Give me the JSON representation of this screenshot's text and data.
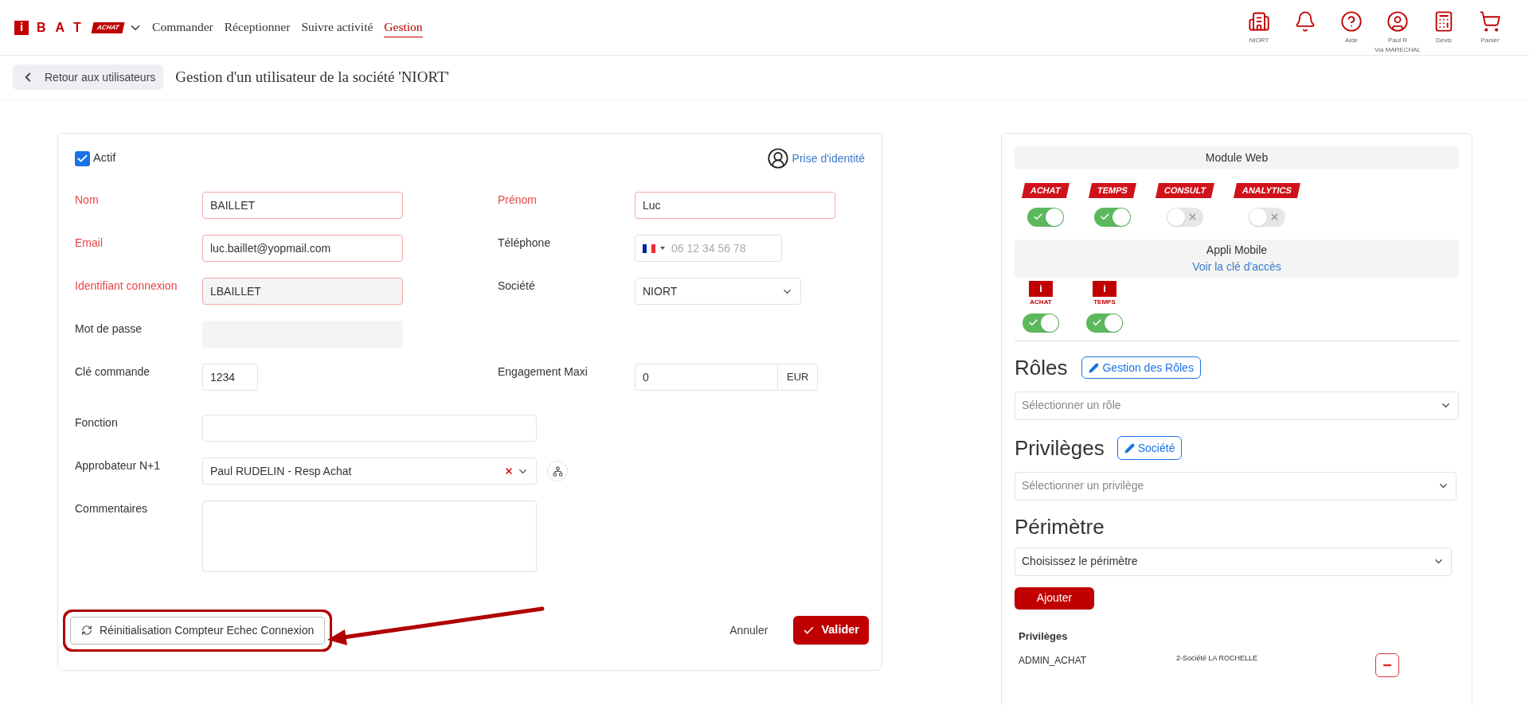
{
  "header": {
    "logo": {
      "mark": "i",
      "name": "BAT",
      "tag": "ACHAT"
    },
    "nav": [
      {
        "label": "Commander",
        "selected": false
      },
      {
        "label": "Réceptionner",
        "selected": false
      },
      {
        "label": "Suivre activité",
        "selected": false
      },
      {
        "label": "Gestion",
        "selected": true
      }
    ],
    "actions": [
      {
        "kind": "building",
        "label": "NIORT"
      },
      {
        "kind": "bell"
      },
      {
        "kind": "help",
        "label": "Aide"
      },
      {
        "kind": "user",
        "label": "Paul R",
        "sublabel": "Via MARECHAL"
      },
      {
        "kind": "calculator",
        "label": "Devis"
      },
      {
        "kind": "cart",
        "label": "Panier"
      }
    ]
  },
  "subheader": {
    "back_button": "Retour aux utilisateurs",
    "title": "Gestion d'un utilisateur de la société 'NIORT'"
  },
  "user_form": {
    "active": {
      "label": "Actif",
      "checked": true
    },
    "impersonate_link": "Prise d'identité",
    "rows": [
      {
        "fields": [
          {
            "kind": "text",
            "label": "Nom",
            "required": true,
            "disabled": false,
            "value": "BAILLET"
          },
          {
            "kind": "text",
            "label": "Prénom",
            "required": true,
            "disabled": false,
            "value": "Luc"
          }
        ]
      },
      {
        "fields": [
          {
            "kind": "text",
            "label": "Email",
            "required": true,
            "disabled": false,
            "value": "luc.baillet@yopmail.com"
          },
          {
            "kind": "phone",
            "label": "Téléphone",
            "required": false,
            "disabled": false,
            "placeholder": "06 12 34 56 78"
          }
        ]
      },
      {
        "fields": [
          {
            "kind": "text",
            "label": "Identifiant connexion",
            "required": true,
            "disabled": true,
            "value": "LBAILLET"
          },
          {
            "kind": "select",
            "label": "Société",
            "required": false,
            "disabled": false,
            "value": "NIORT"
          }
        ]
      },
      {
        "fields": [
          {
            "kind": "text",
            "label": "Mot de passe",
            "required": false,
            "disabled": true
          }
        ]
      },
      {
        "fields": [
          {
            "kind": "short",
            "label": "Clé commande",
            "required": false,
            "disabled": false,
            "value": "1234"
          },
          {
            "kind": "currency",
            "label": "Engagement Maxi",
            "required": false,
            "disabled": false,
            "value": "0",
            "unit": "EUR"
          }
        ]
      },
      {
        "fields": [
          {
            "kind": "wide",
            "label": "Fonction",
            "required": false,
            "disabled": false
          }
        ]
      },
      {
        "fields": [
          {
            "kind": "combo",
            "label": "Approbateur N+1",
            "required": false,
            "disabled": false,
            "value": "Paul RUDELIN - Resp Achat"
          }
        ]
      },
      {
        "fields": [
          {
            "kind": "textarea",
            "label": "Commentaires",
            "required": false,
            "disabled": false
          }
        ]
      }
    ],
    "reset_button": "Réinitialisation Compteur Echec Connexion",
    "cancel_button": "Annuler",
    "submit_button": "Valider"
  },
  "access_panel": {
    "web_title": "Module Web",
    "web_modules": [
      {
        "label": "ACHAT",
        "on": true
      },
      {
        "label": "TEMPS",
        "on": true
      },
      {
        "label": "CONSULT",
        "on": false
      },
      {
        "label": "ANALYTICS",
        "on": false
      }
    ],
    "mobile_title": "Appli Mobile",
    "mobile_link": "Voir la clé d'accès",
    "mobile_apps": [
      {
        "mark": "i",
        "label": "ACHAT",
        "on": true
      },
      {
        "mark": "i",
        "label": "TEMPS",
        "on": true
      }
    ],
    "roles": {
      "title": "Rôles",
      "button": "Gestion des Rôles",
      "placeholder": "Sélectionner un rôle"
    },
    "privileges": {
      "title": "Privilèges",
      "button": "Société",
      "placeholder": "Sélectionner un privilège"
    },
    "scope": {
      "title": "Périmètre",
      "value": "Choisissez le périmètre"
    },
    "add_button": "Ajouter",
    "list_title": "Privilèges",
    "list": [
      {
        "name": "ADMIN_ACHAT",
        "scope": "2-Société LA ROCHELLE"
      }
    ]
  }
}
